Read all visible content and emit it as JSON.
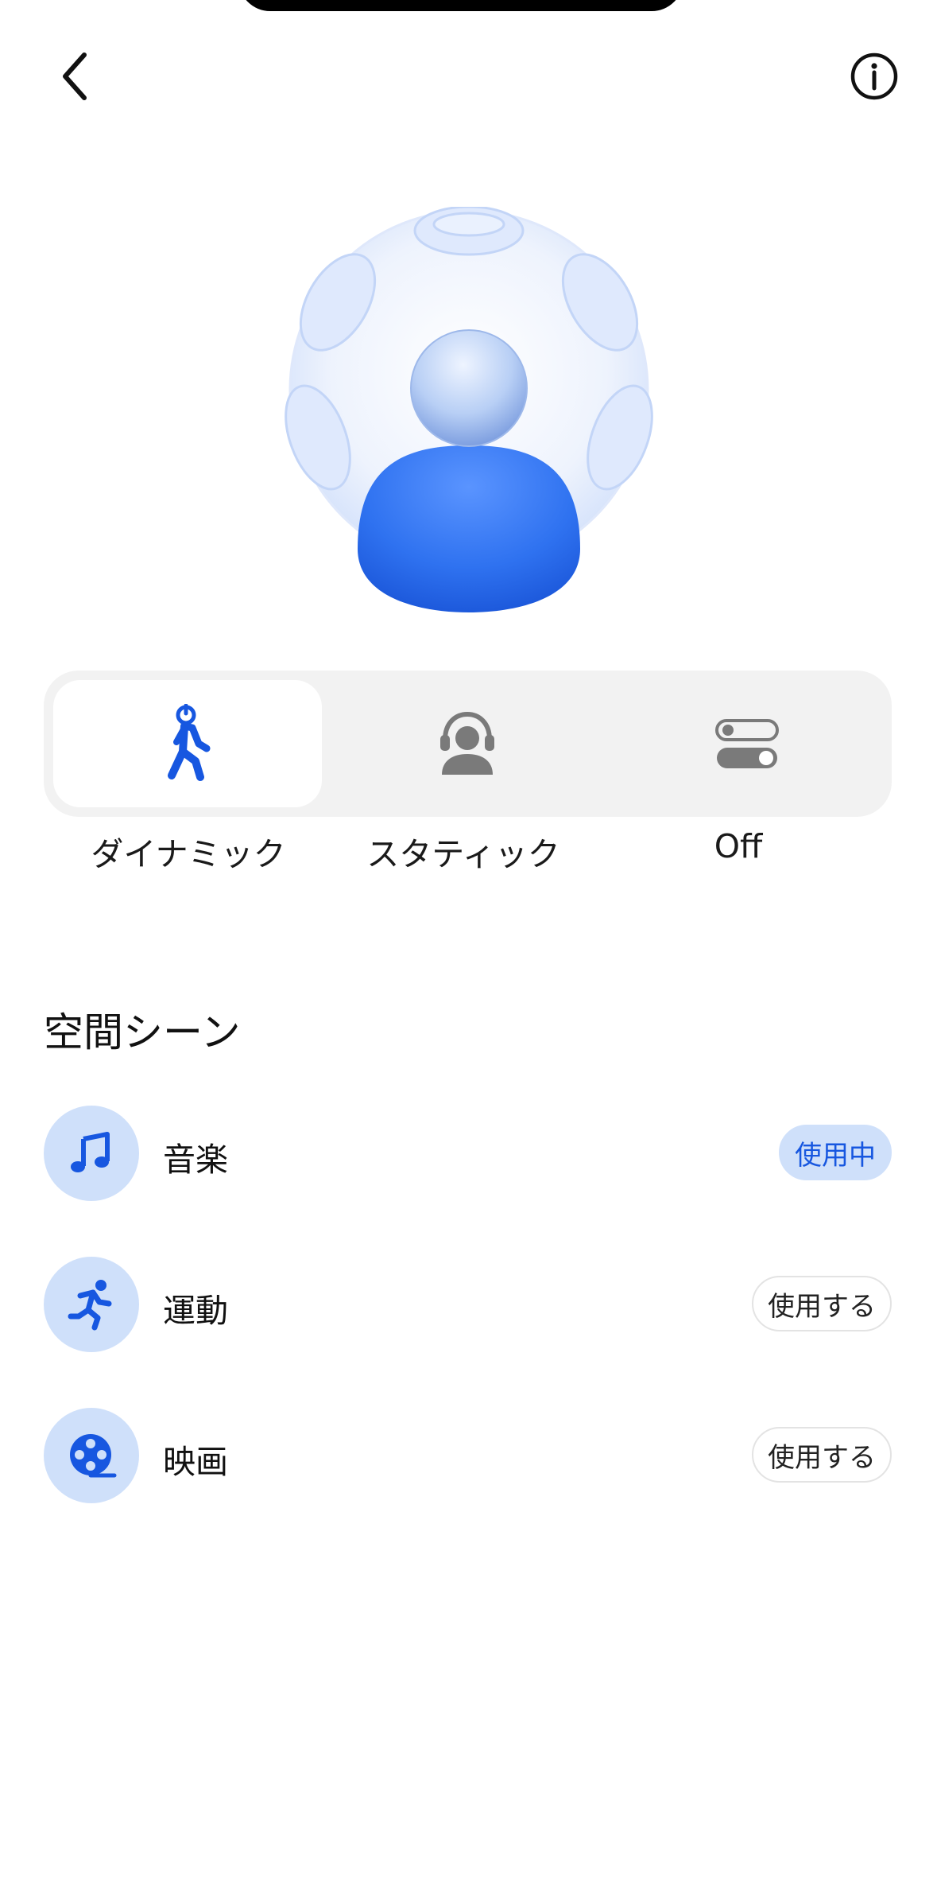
{
  "spatial_modes": [
    {
      "label": "ダイナミック",
      "icon": "walking-person-icon",
      "selected": true
    },
    {
      "label": "スタティック",
      "icon": "person-headphones-icon",
      "selected": false
    },
    {
      "label": "Off",
      "icon": "toggle-switches-icon",
      "selected": false
    }
  ],
  "section_title": "空間シーン",
  "scenes": [
    {
      "label": "音楽",
      "icon": "music-note-icon",
      "action": "使用中",
      "in_use": true
    },
    {
      "label": "運動",
      "icon": "running-person-icon",
      "action": "使用する",
      "in_use": false
    },
    {
      "label": "映画",
      "icon": "film-reel-icon",
      "action": "使用する",
      "in_use": false
    }
  ],
  "colors": {
    "accent": "#1757e0",
    "accent_light": "#cfe0fa",
    "icon_gray": "#7a7a7a",
    "segment_bg": "#f2f2f2"
  }
}
